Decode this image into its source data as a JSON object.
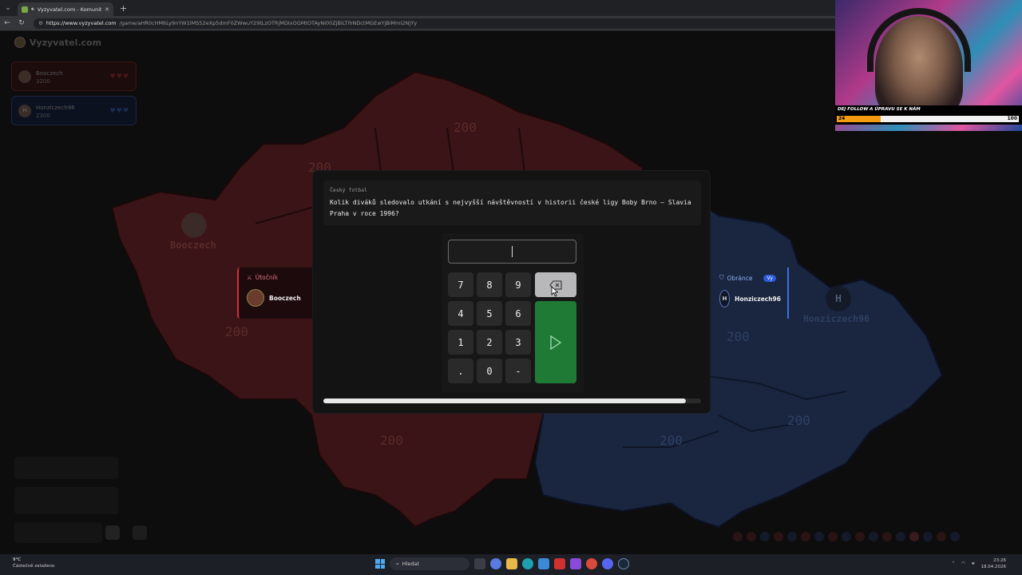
{
  "browser": {
    "tab_title": "Vyzyvatel.com - Komunitní vě",
    "url_domain": "https://www.vyzyvatel.com",
    "url_path": "/game/aHR0cHM6Ly9nYW1lMS52eXp5dmF0ZWwuY29tLzOTRjMDIxOGMtOTAyNi00ZjBiLTlhNDctMGEwYjBiMmI2NjYy"
  },
  "site": {
    "logo_text": "Vyzyvatel.com"
  },
  "players": [
    {
      "name": "Booczech",
      "score": "3200",
      "lives": "♥♥♥",
      "color": "#d32f3f"
    },
    {
      "name": "Honziczech96",
      "initial": "H",
      "badge": "Vy",
      "score": "2300",
      "lives": "♥♥♥",
      "color": "#2c5ad8"
    }
  ],
  "map": {
    "labels": [
      {
        "text": "200",
        "team": "r"
      },
      {
        "text": "200",
        "team": "r"
      },
      {
        "text": "200",
        "team": "r"
      },
      {
        "text": "200",
        "team": "r"
      },
      {
        "text": "200",
        "team": "b"
      },
      {
        "text": "200",
        "team": "b"
      },
      {
        "text": "200",
        "team": "b"
      }
    ],
    "base_red_name": "Booczech",
    "base_blue_name": "Honziczech96",
    "base_blue_initial": "H"
  },
  "attacker": {
    "label": "Útočník",
    "name": "Booczech"
  },
  "defender": {
    "label": "Obránce",
    "badge": "Vy",
    "name": "Honziczech96",
    "initial": "H"
  },
  "question": {
    "category": "Český fotbal",
    "text": "Kolik diváků sledovalo utkání s nejvyšší návštěvností v historii české ligy Boby Brno – Slavia Praha v roce 1996?",
    "answer_value": "",
    "progress": 0.96
  },
  "keypad": {
    "keys": [
      "7",
      "8",
      "9",
      "4",
      "5",
      "6",
      "1",
      "2",
      "3",
      ".",
      "0",
      "-"
    ],
    "backspace_icon": "backspace-icon",
    "submit_icon": "play-icon"
  },
  "stream": {
    "banner_text": "DEJ FOLLOW A ÚPRAVU SE K NÁM",
    "goal_current": "24",
    "goal_target": "100",
    "goal_fraction": 0.24
  },
  "taskbar": {
    "weather_temp": "9°C",
    "weather_desc": "Částečně zataženo",
    "search_placeholder": "Hledat",
    "time": "23:26",
    "date": "18.04.2026"
  }
}
